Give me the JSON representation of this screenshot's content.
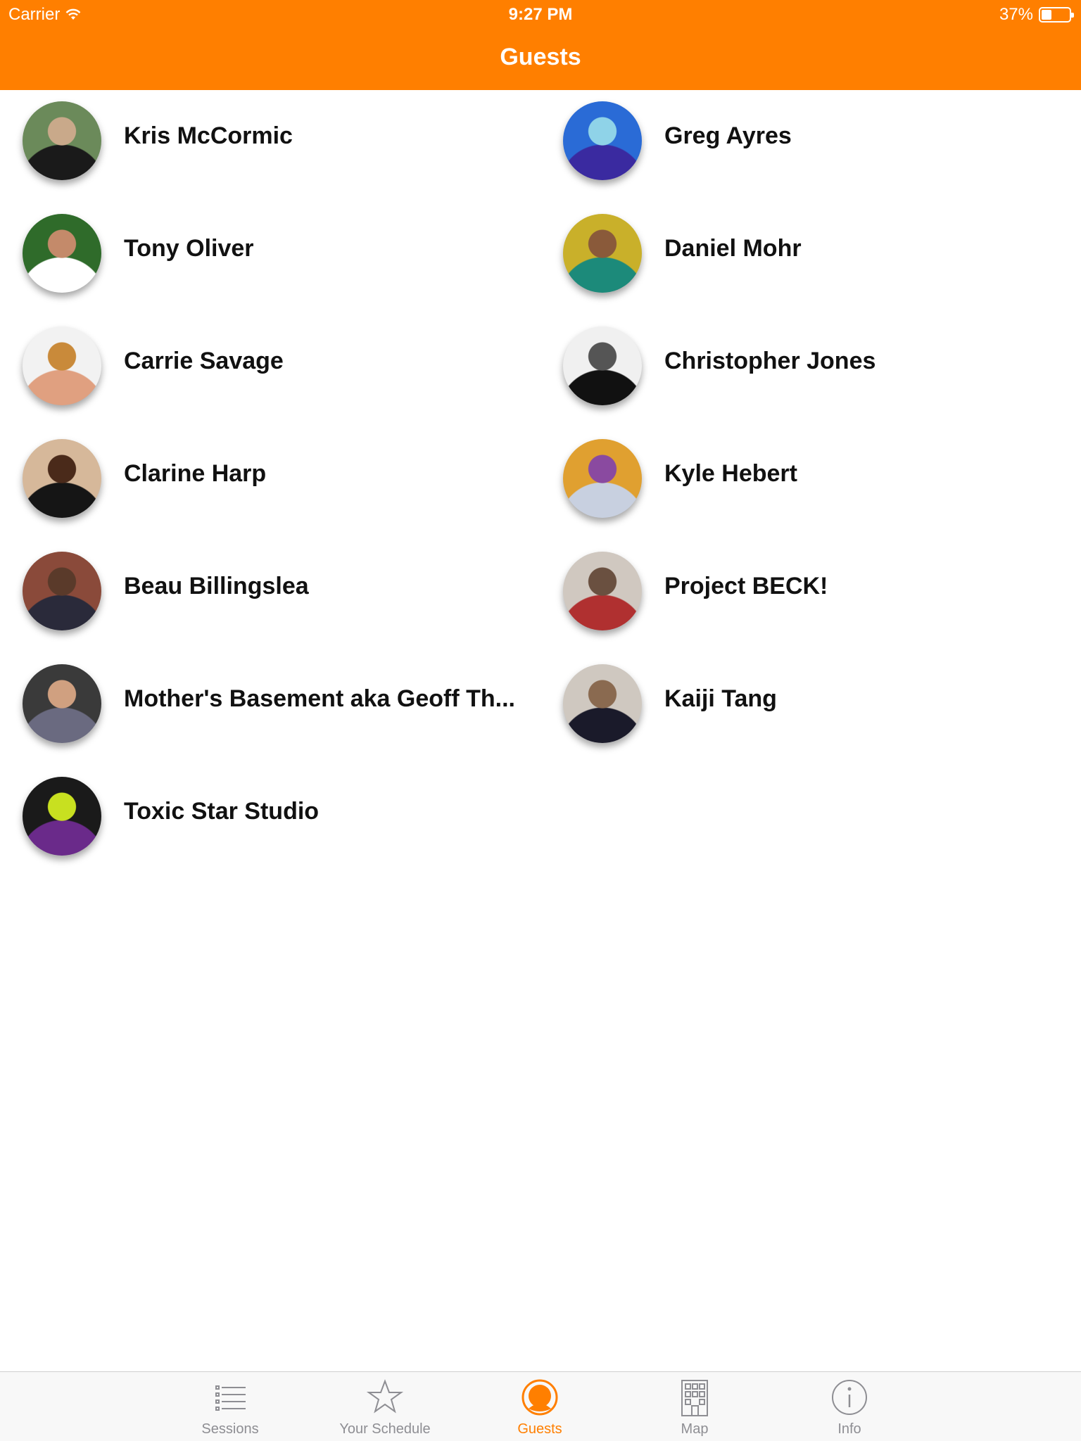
{
  "status_bar": {
    "carrier": "Carrier",
    "time": "9:27 PM",
    "battery": "37%",
    "battery_level": 0.37
  },
  "nav": {
    "title": "Guests"
  },
  "colors": {
    "accent": "#ff7f00",
    "inactive": "#8e8e93"
  },
  "guests": [
    {
      "name": "Kris McCormic",
      "avatar_colors": [
        "#6b8a5a",
        "#c9a98a",
        "#1a1a1a"
      ]
    },
    {
      "name": "Greg Ayres",
      "avatar_colors": [
        "#2a6bd6",
        "#8fd3e8",
        "#3a2aa0"
      ]
    },
    {
      "name": "Tony Oliver",
      "avatar_colors": [
        "#2f6b2a",
        "#c48a6a",
        "#ffffff"
      ]
    },
    {
      "name": "Daniel Mohr",
      "avatar_colors": [
        "#c9b02a",
        "#8a5a3a",
        "#1c8a7a"
      ]
    },
    {
      "name": "Carrie Savage",
      "avatar_colors": [
        "#f2f2f2",
        "#c98a3a",
        "#e0a080"
      ]
    },
    {
      "name": "Christopher Jones",
      "avatar_colors": [
        "#f0f0f0",
        "#555555",
        "#111111"
      ]
    },
    {
      "name": "Clarine Harp",
      "avatar_colors": [
        "#d6b89a",
        "#4a2a1a",
        "#151515"
      ]
    },
    {
      "name": "Kyle Hebert",
      "avatar_colors": [
        "#e0a030",
        "#8a4aa0",
        "#c8d0e0"
      ]
    },
    {
      "name": "Beau Billingslea",
      "avatar_colors": [
        "#8a4a3a",
        "#5a3a2a",
        "#2a2a3a"
      ]
    },
    {
      "name": "Project BECK!",
      "avatar_colors": [
        "#d0c8c0",
        "#6a5040",
        "#b03030"
      ]
    },
    {
      "name": "Mother's Basement aka Geoff Th...",
      "avatar_colors": [
        "#3a3a3a",
        "#d0a080",
        "#6a6a80"
      ]
    },
    {
      "name": "Kaiji Tang",
      "avatar_colors": [
        "#cfc8c0",
        "#8a6a50",
        "#1a1a2a"
      ]
    },
    {
      "name": "Toxic Star Studio",
      "avatar_colors": [
        "#1a1a1a",
        "#c8e020",
        "#6a2a8a"
      ]
    }
  ],
  "tabs": [
    {
      "label": "Sessions",
      "icon": "list-icon",
      "active": false
    },
    {
      "label": "Your Schedule",
      "icon": "star-icon",
      "active": false
    },
    {
      "label": "Guests",
      "icon": "person-icon",
      "active": true
    },
    {
      "label": "Map",
      "icon": "building-icon",
      "active": false
    },
    {
      "label": "Info",
      "icon": "info-icon",
      "active": false
    }
  ]
}
